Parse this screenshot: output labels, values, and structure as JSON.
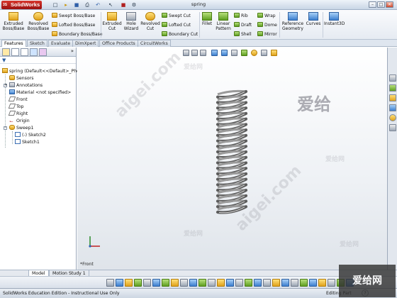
{
  "app": {
    "logo_text": "SolidWorks",
    "document_title": "spring"
  },
  "window_controls": {
    "minimize": "–",
    "restore": "□",
    "close": "✕"
  },
  "quick_access": {
    "new_icon": "□",
    "open_icon": "▸",
    "save_icon": "■",
    "print_icon": "⎙",
    "undo_icon": "↶",
    "select_icon": "↖",
    "options_icon": "⚙"
  },
  "command_manager": {
    "extruded_boss": "Extruded Boss/Base",
    "revolved_boss": "Revolved Boss/Base",
    "swept_boss": "Swept Boss/Base",
    "lofted_boss": "Lofted Boss/Base",
    "boundary_boss": "Boundary Boss/Base",
    "extruded_cut": "Extruded Cut",
    "hole_wizard": "Hole Wizard",
    "revolved_cut": "Revolved Cut",
    "swept_cut": "Swept Cut",
    "lofted_cut": "Lofted Cut",
    "boundary_cut": "Boundary Cut",
    "fillet": "Fillet",
    "linear_pattern": "Linear Pattern",
    "rib": "Rib",
    "draft": "Draft",
    "shell": "Shell",
    "wrap": "Wrap",
    "dome": "Dome",
    "mirror": "Mirror",
    "reference_geometry": "Reference Geometry",
    "curves": "Curves",
    "instant3d": "Instant3D"
  },
  "tabs": [
    "Features",
    "Sketch",
    "Evaluate",
    "DimXpert",
    "Office Products",
    "CircuitWorks"
  ],
  "feature_tree": {
    "root": "spring  (Default<<Default>_Photo\\",
    "items": [
      "Sensors",
      "Annotations",
      "Material <not specified>",
      "Front",
      "Top",
      "Right",
      "Origin",
      "Sweep1",
      "(-) Sketch2",
      "Sketch1"
    ]
  },
  "viewport": {
    "view_label": "*Front"
  },
  "bottom_tabs": [
    "Model",
    "Motion Study 1"
  ],
  "status": {
    "edition": "SolidWorks Education Edition - Instructional Use Only",
    "mode": "Editing Part",
    "help": "?"
  },
  "watermarks": {
    "big": "爱给",
    "small": "爱给网",
    "domain": "aigei.com"
  },
  "colors": {
    "accent": "#2d5f9f",
    "spring": "#5d5d5d",
    "tab_active": "#ffffff"
  },
  "icons": {
    "fm_tabs": [
      "feature-manager-icon",
      "property-manager-icon",
      "configuration-manager-icon",
      "dimxpert-manager-icon",
      "display-manager-icon"
    ],
    "tree": [
      "part-icon",
      "sensors-icon",
      "annotations-icon",
      "material-icon",
      "plane-icon",
      "plane-icon",
      "plane-icon",
      "origin-icon",
      "sweep-icon",
      "sketch-icon",
      "sketch-icon"
    ]
  }
}
